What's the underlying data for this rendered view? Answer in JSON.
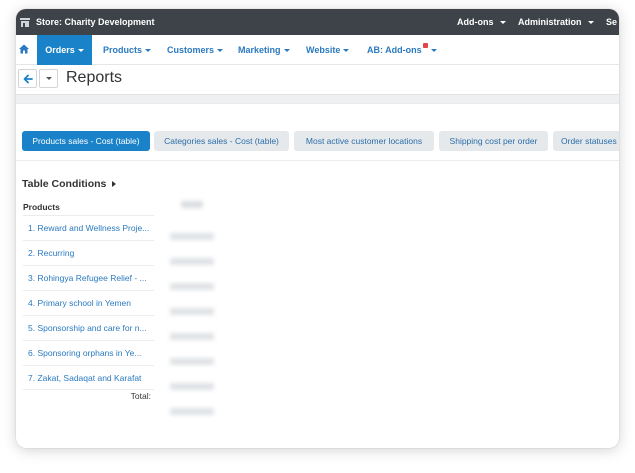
{
  "topbar": {
    "store": "Store: Charity Development",
    "menu": [
      {
        "label": "Add-ons"
      },
      {
        "label": "Administration"
      },
      {
        "label": "Se"
      }
    ]
  },
  "nav": [
    {
      "label": "Orders",
      "active": true
    },
    {
      "label": "Products"
    },
    {
      "label": "Customers"
    },
    {
      "label": "Marketing"
    },
    {
      "label": "Website"
    },
    {
      "label": "AB: Add-ons"
    }
  ],
  "page": {
    "title": "Reports"
  },
  "tabs": [
    {
      "label": "Products sales - Cost (table)",
      "active": true
    },
    {
      "label": "Categories sales - Cost (table)"
    },
    {
      "label": "Most active customer locations"
    },
    {
      "label": "Shipping cost per order"
    },
    {
      "label": "Order statuses"
    }
  ],
  "table": {
    "conditions_label": "Table Conditions",
    "products_header": "Products",
    "rows": [
      "1. Reward and Wellness Proje...",
      "2. Recurring",
      "3. Rohingya Refugee Relief - ...",
      "4. Primary school in Yemen",
      "5. Sponsorship and care for n...",
      "6. Sponsoring orphans in Ye...",
      "7. Zakat, Sadaqat and Karafat"
    ],
    "total_label": "Total:"
  },
  "colors": {
    "topbar": "#3d4348",
    "accent": "#1a82c9",
    "link": "#2b7ac0",
    "tab_bg": "#e6e9ec",
    "badge": "#e7434b"
  }
}
